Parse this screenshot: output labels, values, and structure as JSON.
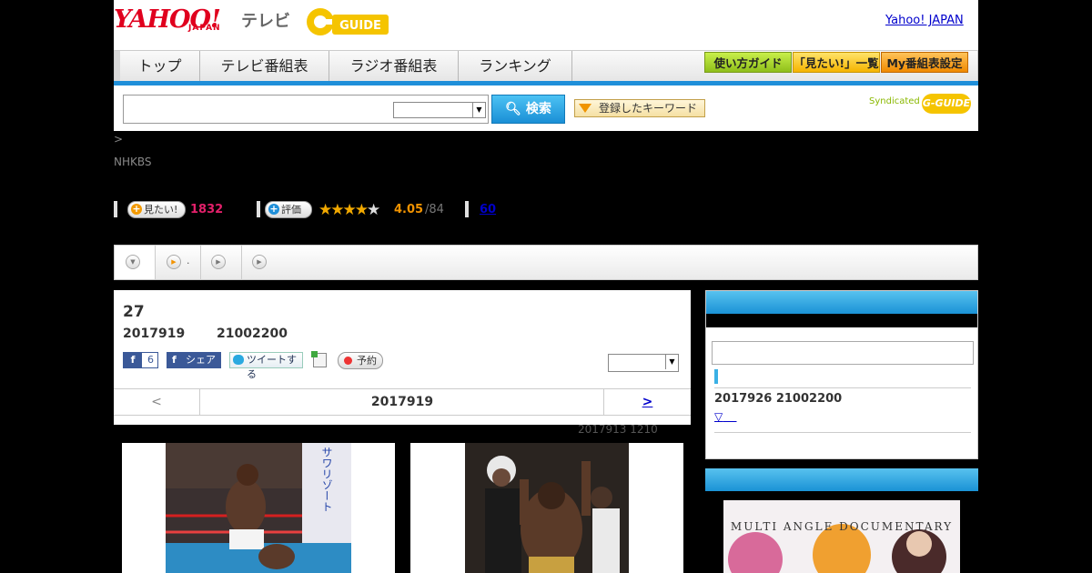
{
  "header": {
    "yahoo_logo": "YAHOO!",
    "japan_logo": "JAPAN",
    "tv_label": "テレビ",
    "gguide_logo": "G-GUIDE",
    "yahoo_japan_link": "Yahoo! JAPAN"
  },
  "nav": {
    "tabs": [
      "トップ",
      "テレビ番組表",
      "ラジオ番組表",
      "ランキング"
    ],
    "right_buttons": [
      "使い方ガイド",
      "「見たい!」一覧",
      "My番組表設定"
    ]
  },
  "search": {
    "input_value": "",
    "search_button": "検索",
    "keyword_button": "登録したキーワード",
    "syndicated_label": "Syndicated",
    "syndicated_logo": "G-GUIDE"
  },
  "breadcrumb": ">",
  "channel": "NHKBS",
  "stats": {
    "want_button": "見たい!",
    "want_count": "1832",
    "rating_button": "評価",
    "rating_value": "4.05",
    "rating_count": "/84",
    "review_link": "60",
    "stars_filled": 4,
    "stars_total": 5
  },
  "program": {
    "title": "27",
    "date": "2017919",
    "time": "21002200",
    "fb_like_count": "6",
    "fb_share_label": "シェア",
    "tweet_label": "ツイートする",
    "reserve_label": "予約",
    "prev_label": "<",
    "nav_date": "2017919",
    "next_label": ">",
    "updated": "2017913  1210"
  },
  "sidebar": {
    "broadcast_date": "2017926  21002200",
    "more_link": "▽",
    "ad_text": "MULTI ANGLE DOCUMENTARY"
  },
  "colors": {
    "brand_red": "#e0001e",
    "accent_blue": "#1f8fd9",
    "want_pink": "#e2206a",
    "rating_orange": "#f29300"
  }
}
